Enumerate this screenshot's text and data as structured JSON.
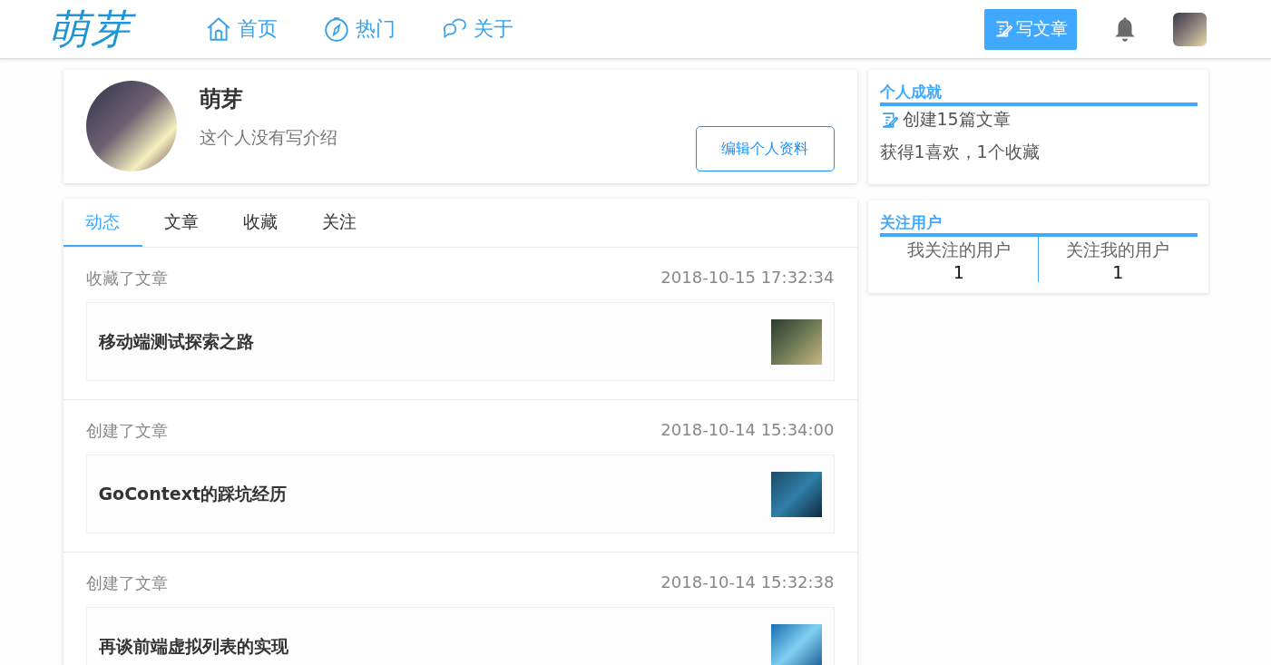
{
  "header": {
    "logo": "萌芽",
    "nav": [
      {
        "label": "首页"
      },
      {
        "label": "热门"
      },
      {
        "label": "关于"
      }
    ],
    "write_button": "写文章"
  },
  "profile": {
    "name": "萌芽",
    "bio": "这个人没有写介绍",
    "edit_button": "编辑个人资料"
  },
  "tabs": [
    {
      "label": "动态",
      "selected": true
    },
    {
      "label": "文章",
      "selected": false
    },
    {
      "label": "收藏",
      "selected": false
    },
    {
      "label": "关注",
      "selected": false
    }
  ],
  "feed": [
    {
      "action": "收藏了文章",
      "time": "2018-10-15 17:32:34",
      "title": "移动端测试探索之路"
    },
    {
      "action": "创建了文章",
      "time": "2018-10-14 15:34:00",
      "title": "GoContext的踩坑经历"
    },
    {
      "action": "创建了文章",
      "time": "2018-10-14 15:32:38",
      "title": "再谈前端虚拟列表的实现"
    }
  ],
  "achievements": {
    "title": "个人成就",
    "articles": "创建15篇文章",
    "stats": "获得1喜欢，1个收藏"
  },
  "follow": {
    "title": "关注用户",
    "columns": [
      {
        "label": "我关注的用户",
        "count": "1"
      },
      {
        "label": "关注我的用户",
        "count": "1"
      }
    ]
  }
}
